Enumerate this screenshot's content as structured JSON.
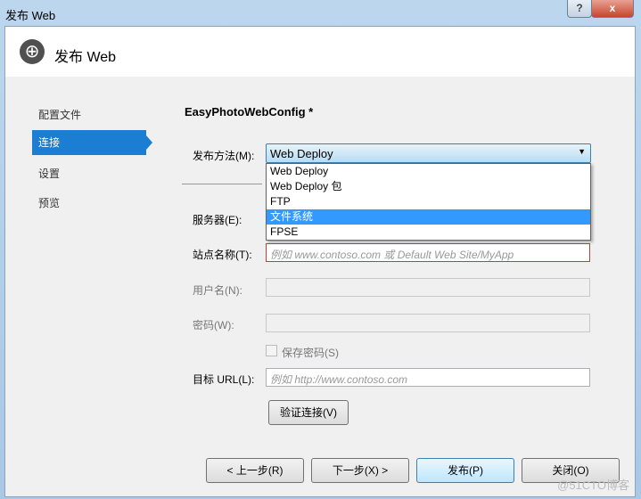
{
  "window": {
    "title": "发布 Web",
    "help": "?",
    "close": "x"
  },
  "header": {
    "title": "发布 Web",
    "icon": "globe-publish-icon"
  },
  "nav": [
    {
      "label": "配置文件"
    },
    {
      "label": "连接",
      "active": true
    },
    {
      "label": "设置"
    },
    {
      "label": "预览"
    }
  ],
  "profile_name": "EasyPhotoWebConfig *",
  "form": {
    "method_label": "发布方法(M):",
    "method_value": "Web Deploy",
    "method_options": [
      "Web Deploy",
      "Web Deploy 包",
      "FTP",
      "文件系统",
      "FPSE"
    ],
    "highlighted_option": "文件系统",
    "server_label": "服务器(E):",
    "site_label": "站点名称(T):",
    "site_placeholder": "例如 www.contoso.com 或 Default Web Site/MyApp",
    "user_label": "用户名(N):",
    "password_label": "密码(W):",
    "save_password": "保存密码(S)",
    "url_label": "目标 URL(L):",
    "url_placeholder": "例如 http://www.contoso.com",
    "validate": "验证连接(V)"
  },
  "buttons": {
    "prev": "< 上一步(R)",
    "next": "下一步(X) >",
    "publish": "发布(P)",
    "close": "关闭(O)"
  },
  "watermark": "@51CTO博客"
}
